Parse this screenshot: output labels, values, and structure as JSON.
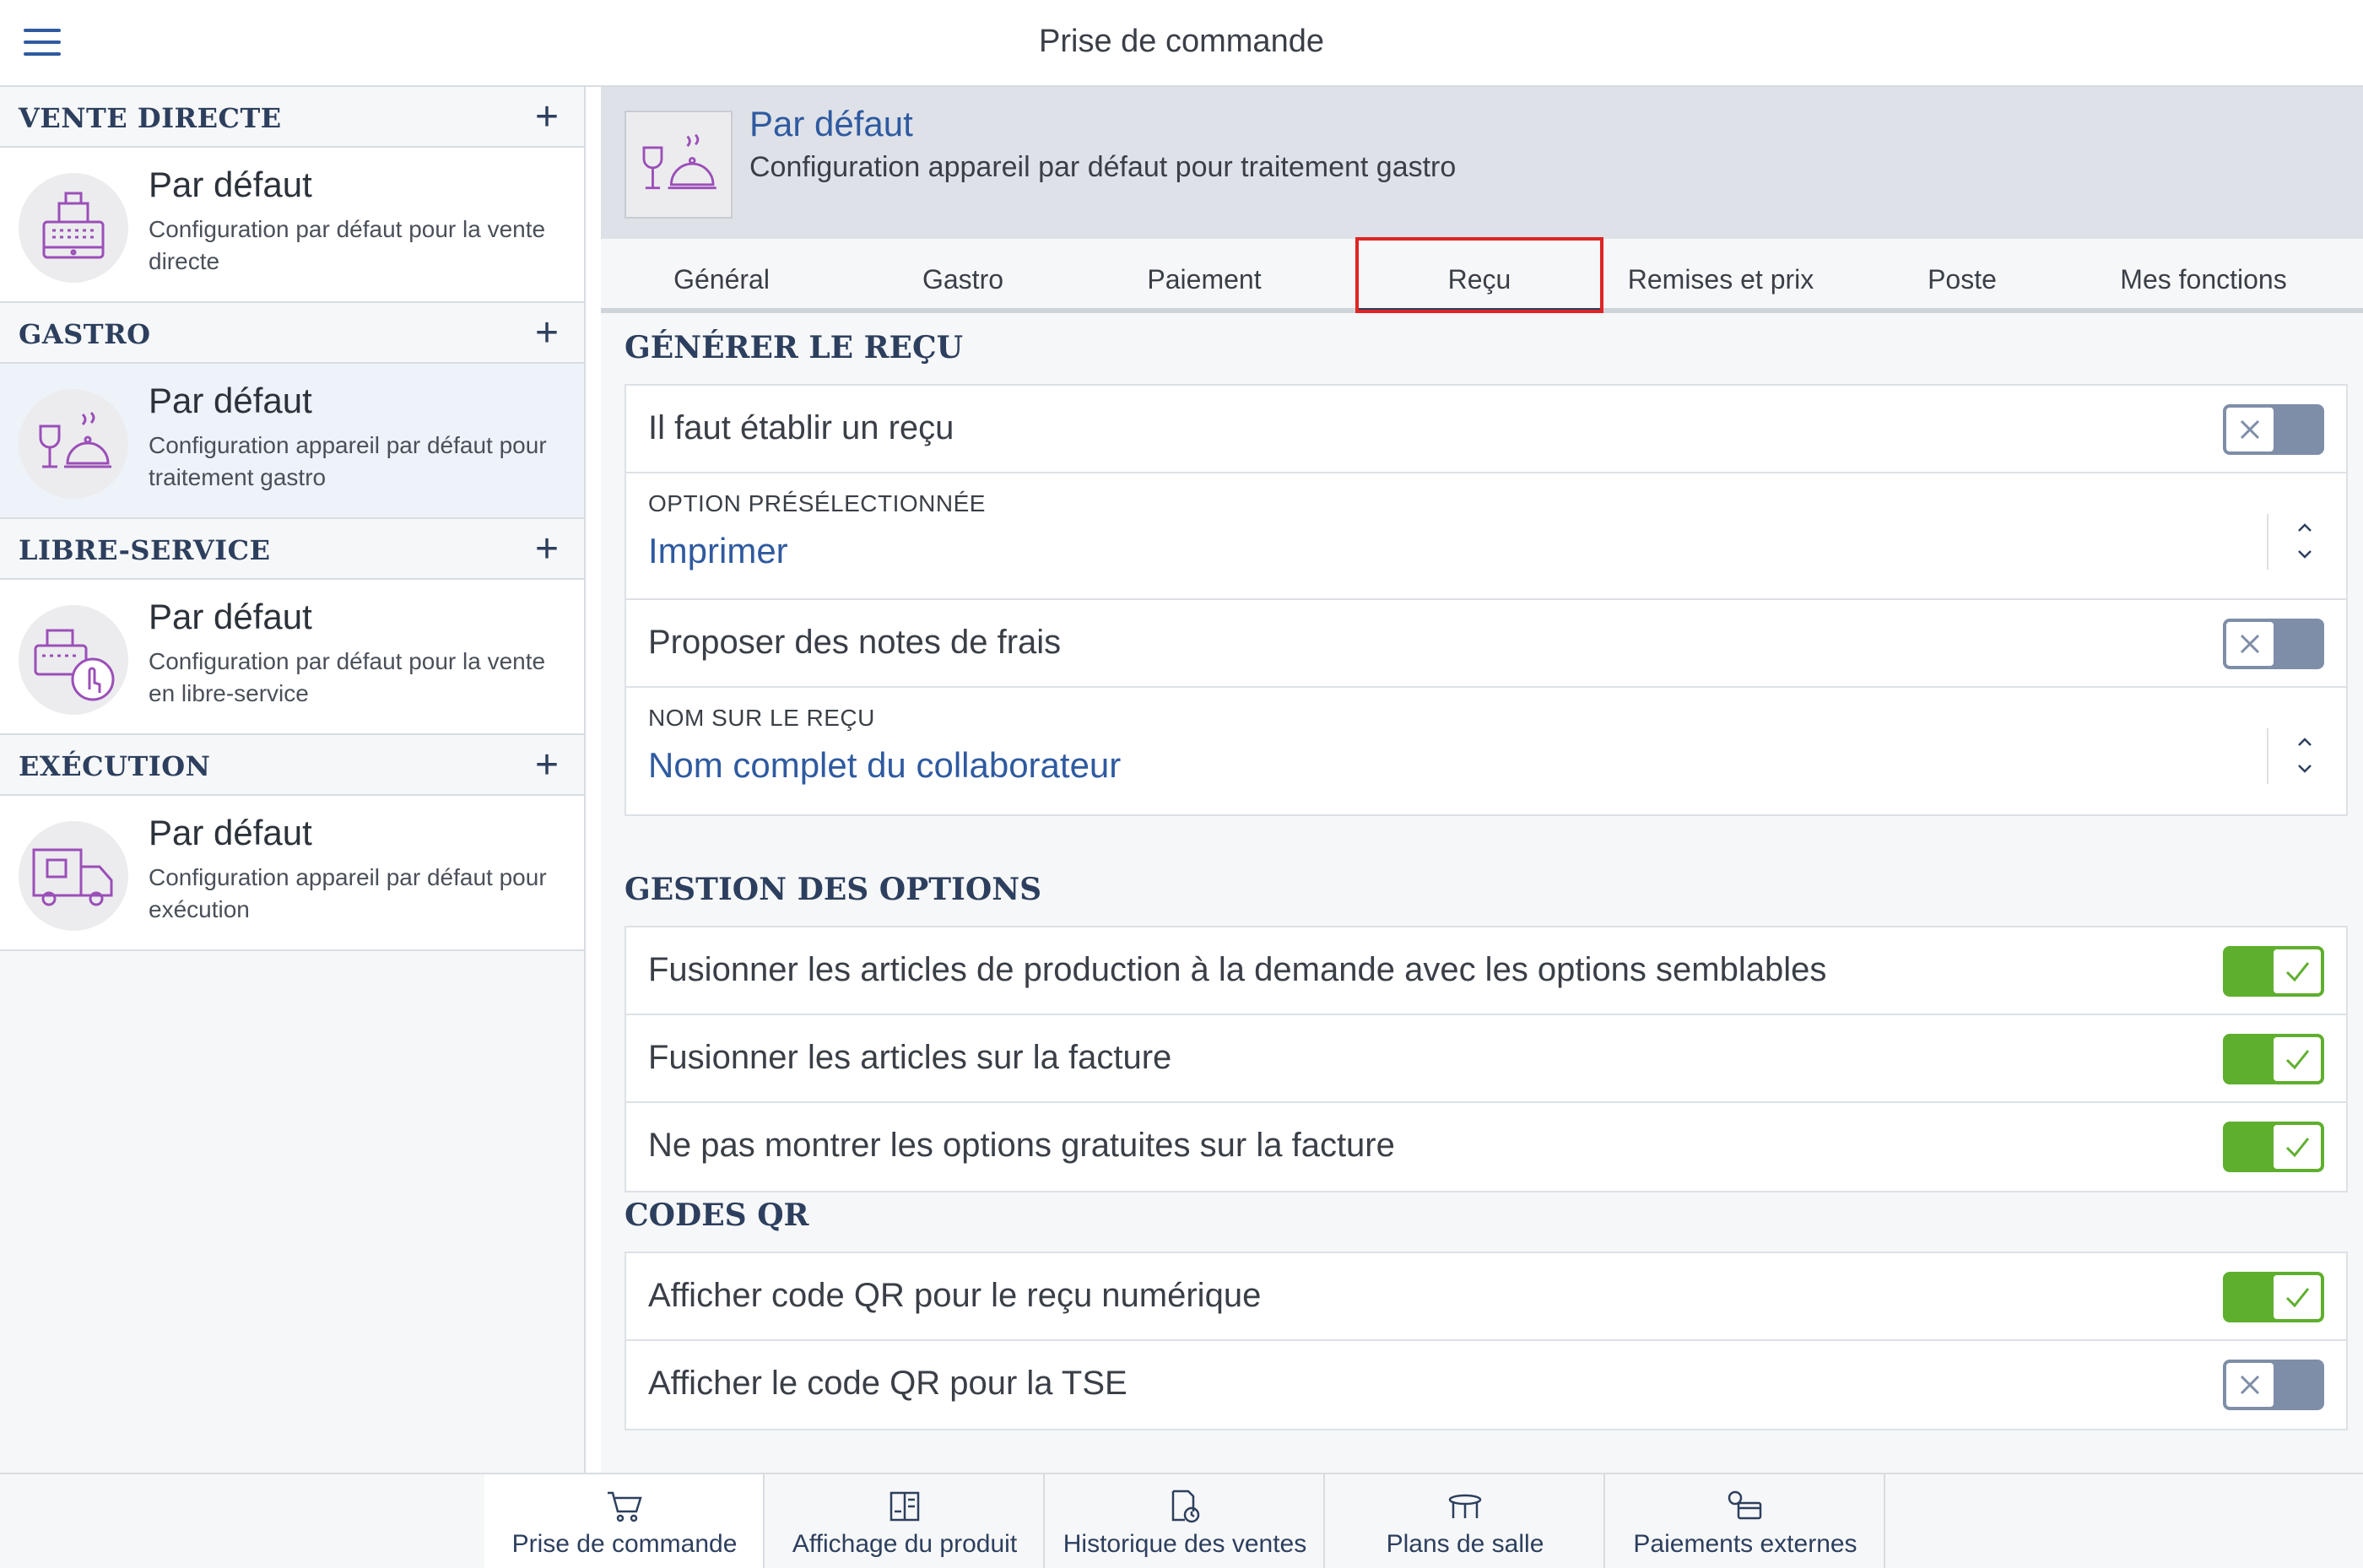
{
  "topbar": {
    "title": "Prise de commande"
  },
  "sidebar": {
    "sections": [
      {
        "title": "VENTE DIRECTE",
        "item": {
          "title": "Par défaut",
          "desc": "Configuration par défaut pour la vente directe",
          "icon": "cash-register-icon"
        }
      },
      {
        "title": "GASTRO",
        "item": {
          "title": "Par défaut",
          "desc": "Configuration appareil par défaut pour traitement gastro",
          "icon": "wine-cloche-icon"
        }
      },
      {
        "title": "LIBRE-SERVICE",
        "item": {
          "title": "Par défaut",
          "desc": "Configuration par défaut pour la vente en libre-service",
          "icon": "self-service-icon"
        }
      },
      {
        "title": "EXÉCUTION",
        "item": {
          "title": "Par défaut",
          "desc": "Configuration appareil par défaut pour exécution",
          "icon": "delivery-truck-icon"
        }
      }
    ]
  },
  "hero": {
    "title": "Par défaut",
    "subtitle": "Configuration appareil par défaut pour traitement gastro"
  },
  "tabs": [
    "Général",
    "Gastro",
    "Paiement",
    "Reçu",
    "Remises et prix",
    "Poste",
    "Mes fonctions"
  ],
  "active_tab": "Reçu",
  "receipt": {
    "title": "GÉNÉRER LE REÇU",
    "must_receipt": {
      "label": "Il faut établir un reçu",
      "on": false
    },
    "preselected": {
      "label": "OPTION PRÉSÉLECTIONNÉE",
      "value": "Imprimer"
    },
    "expense_notes": {
      "label": "Proposer des notes de frais",
      "on": false
    },
    "name_on_receipt": {
      "label": "NOM SUR LE REÇU",
      "value": "Nom complet du collaborateur"
    }
  },
  "options": {
    "title": "GESTION DES OPTIONS",
    "rows": [
      {
        "label": "Fusionner les articles de production à la demande avec les options semblables",
        "on": true
      },
      {
        "label": "Fusionner les articles sur la facture",
        "on": true
      },
      {
        "label": "Ne pas montrer les options gratuites sur la facture",
        "on": true
      }
    ]
  },
  "qr": {
    "title": "CODES QR",
    "rows": [
      {
        "label": "Afficher code QR pour le reçu numérique",
        "on": true
      },
      {
        "label": "Afficher le code QR pour la TSE",
        "on": false
      }
    ]
  },
  "bottomnav": [
    {
      "label": "Prise de commande",
      "icon": "cart-icon",
      "active": true
    },
    {
      "label": "Affichage du produit",
      "icon": "product-display-icon",
      "active": false
    },
    {
      "label": "Historique des ventes",
      "icon": "sales-history-icon",
      "active": false
    },
    {
      "label": "Plans de salle",
      "icon": "table-icon",
      "active": false
    },
    {
      "label": "Paiements externes",
      "icon": "external-payment-icon",
      "active": false
    }
  ],
  "colors": {
    "accent": "#2f5aa0",
    "on": "#5faf2e",
    "off": "#7f8ea8",
    "highlight": "#e02424",
    "icon_line": "#9b4fb8"
  }
}
